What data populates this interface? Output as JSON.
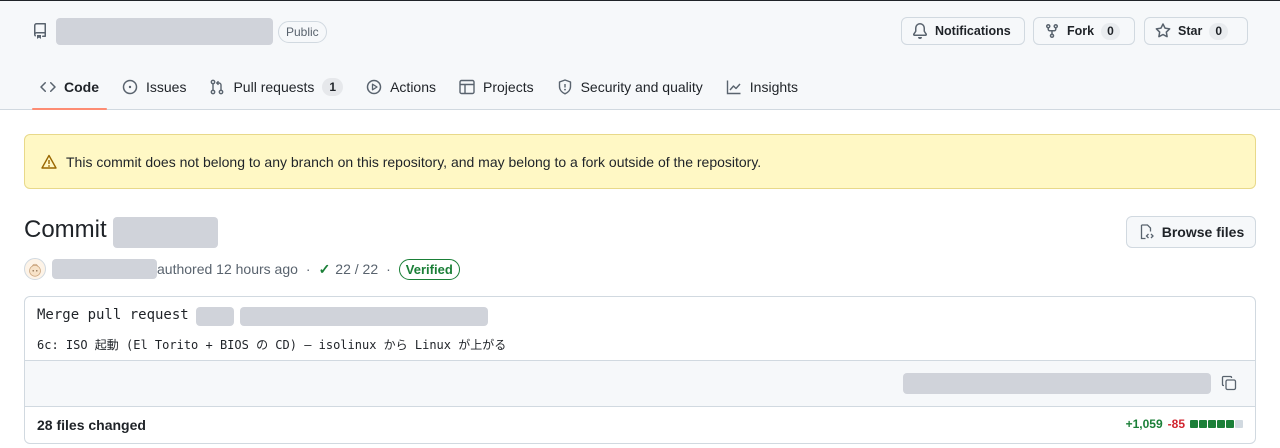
{
  "header": {
    "visibility_badge": "Public",
    "buttons": {
      "notifications_label": "Notifications",
      "fork_label": "Fork",
      "fork_count": "0",
      "star_label": "Star",
      "star_count": "0"
    },
    "tabs": [
      {
        "label": "Code",
        "icon": "code-icon",
        "active": true
      },
      {
        "label": "Issues",
        "icon": "issue-icon"
      },
      {
        "label": "Pull requests",
        "icon": "pull-request-icon",
        "count": "1"
      },
      {
        "label": "Actions",
        "icon": "play-icon"
      },
      {
        "label": "Projects",
        "icon": "table-icon"
      },
      {
        "label": "Security and quality",
        "icon": "shield-icon"
      },
      {
        "label": "Insights",
        "icon": "graph-icon"
      }
    ]
  },
  "flash": {
    "message": "This commit does not belong to any branch on this repository, and may belong to a fork outside of the repository."
  },
  "commit": {
    "title": "Commit",
    "browse_files_label": "Browse files",
    "authored_text": "authored 12 hours ago",
    "checks": "22 / 22",
    "verified_label": "Verified",
    "message_title": "Merge pull request",
    "message_body": "6c: ISO 起動 (El Torito + BIOS の CD) — isolinux から Linux が上がる",
    "files_changed": "28 files changed",
    "additions": "+1,059",
    "deletions": "-85",
    "diff_blocks": [
      "add",
      "add",
      "add",
      "add",
      "add",
      "neutral"
    ]
  },
  "colors": {
    "accent_underline": "#fd8c73",
    "addition": "#1a7f37",
    "deletion": "#d1242f",
    "flash_bg": "#fff8c5"
  }
}
